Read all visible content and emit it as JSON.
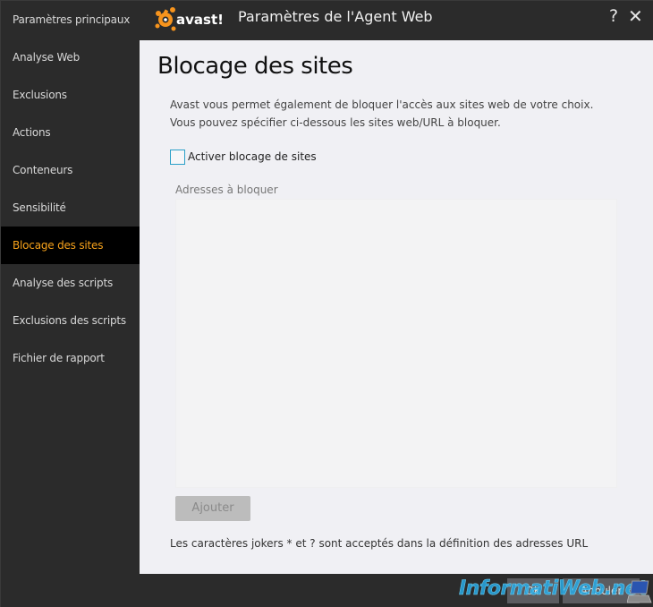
{
  "window": {
    "brand": "avast!",
    "title": "Paramètres de l'Agent Web",
    "help_glyph": "?",
    "close_glyph": "✕",
    "accent_color": "#f7a21b"
  },
  "sidebar": {
    "items": [
      {
        "label": "Paramètres principaux",
        "active": false
      },
      {
        "label": "Analyse Web",
        "active": false
      },
      {
        "label": "Exclusions",
        "active": false
      },
      {
        "label": "Actions",
        "active": false
      },
      {
        "label": "Conteneurs",
        "active": false
      },
      {
        "label": "Sensibilité",
        "active": false
      },
      {
        "label": "Blocage des sites",
        "active": true
      },
      {
        "label": "Analyse des scripts",
        "active": false
      },
      {
        "label": "Exclusions des scripts",
        "active": false
      },
      {
        "label": "Fichier de rapport",
        "active": false
      }
    ]
  },
  "main": {
    "heading": "Blocage des sites",
    "description": "Avast vous permet également de bloquer l'accès aux sites web de votre choix. Vous pouvez spécifier ci-dessous les sites web/URL à bloquer.",
    "enable_checkbox": {
      "label": "Activer blocage de sites",
      "checked": false
    },
    "addresses_label": "Adresses à bloquer",
    "addresses": [],
    "add_button": "Ajouter",
    "note": "Les caractères jokers * et ? sont acceptés dans la définition des adresses URL"
  },
  "footer": {
    "ok_label": "OK",
    "cancel_label": "Annuler"
  },
  "watermark": {
    "text": "InformatiWeb.net"
  }
}
